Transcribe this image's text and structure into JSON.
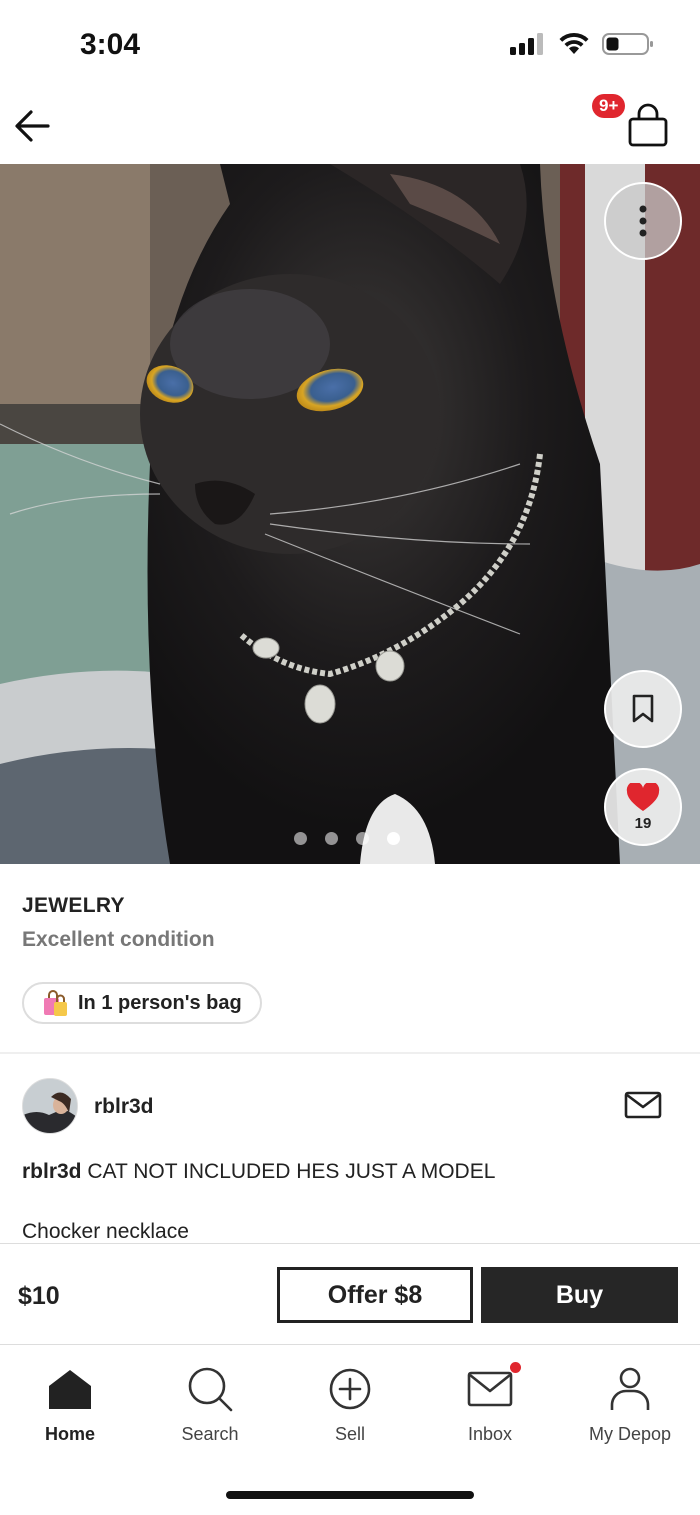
{
  "status_bar": {
    "time": "3:04"
  },
  "nav": {
    "back_icon": "arrow-left-icon",
    "bag_icon": "shopping-bag-icon",
    "bag_badge": "9+"
  },
  "product": {
    "image_alt": "Black cat wearing a silver moonstone choker necklace",
    "image_count": 4,
    "active_image": 4,
    "likes": "19",
    "category": "JEWELRY",
    "condition": "Excellent condition",
    "bag_note": "In 1 person's bag"
  },
  "seller": {
    "username": "rblr3d",
    "description_user": "rblr3d",
    "description_text": "CAT NOT INCLUDED HES JUST A MODEL",
    "description_line2": "Chocker necklace"
  },
  "purchase": {
    "price": "$10",
    "offer_label": "Offer $8",
    "buy_label": "Buy"
  },
  "tabs": [
    {
      "label": "Home",
      "icon": "home-icon",
      "active": true
    },
    {
      "label": "Search",
      "icon": "search-icon",
      "active": false
    },
    {
      "label": "Sell",
      "icon": "plus-circle-icon",
      "active": false
    },
    {
      "label": "Inbox",
      "icon": "mail-icon",
      "active": false,
      "badge": true
    },
    {
      "label": "My Depop",
      "icon": "user-icon",
      "active": false
    }
  ],
  "colors": {
    "badge_red": "#e0262e",
    "heart_red": "#e0262e",
    "button_dark": "#262626"
  }
}
